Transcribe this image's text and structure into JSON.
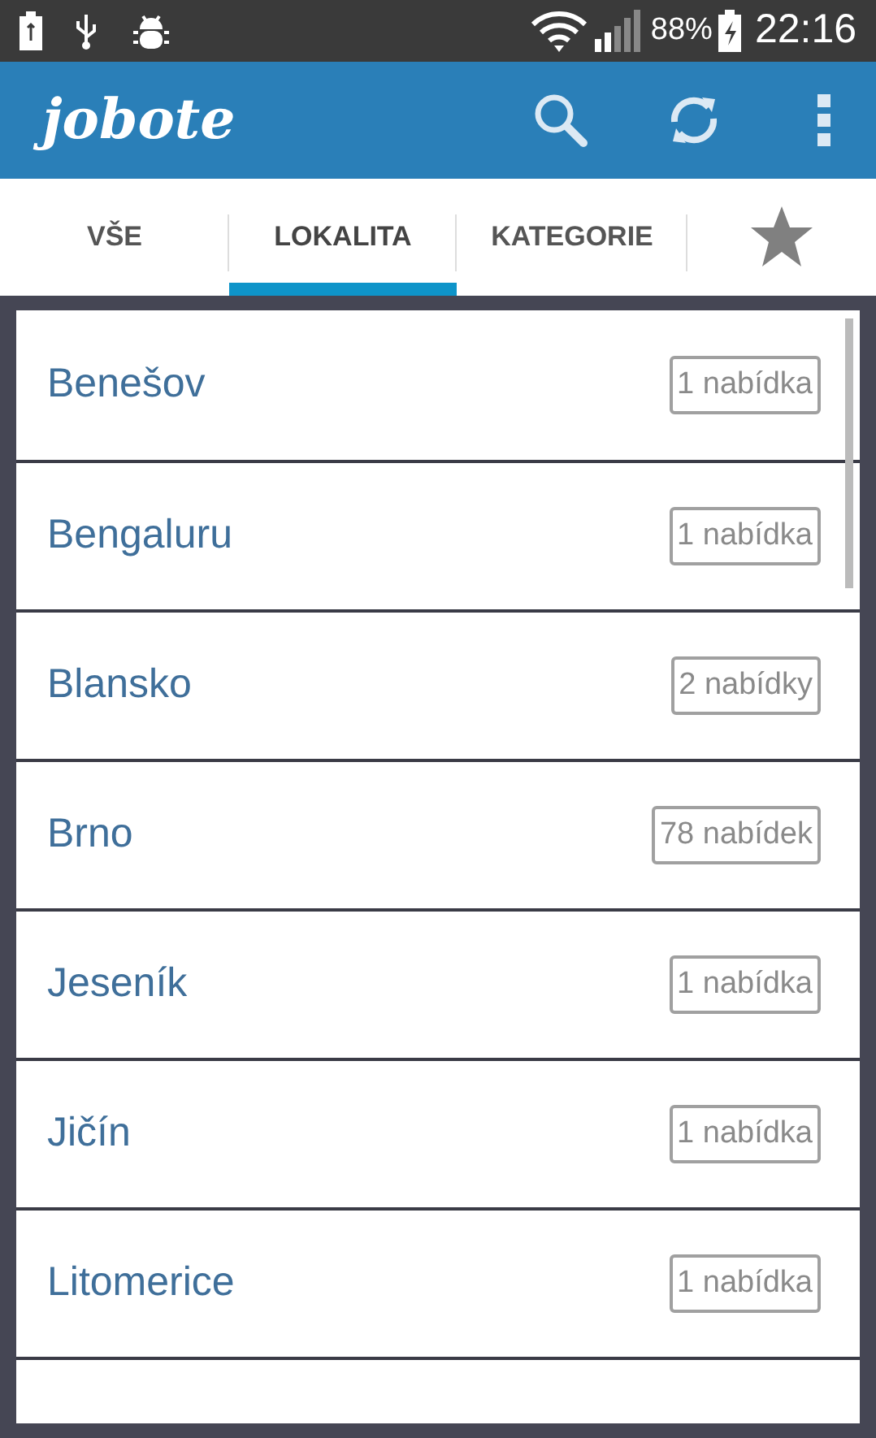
{
  "status_bar": {
    "battery_percent": "88%",
    "time": "22:16"
  },
  "app_bar": {
    "logo": "jobote"
  },
  "tabs": [
    {
      "kind": "text",
      "label": "VŠE",
      "selected": false
    },
    {
      "kind": "text",
      "label": "LOKALITA",
      "selected": true
    },
    {
      "kind": "text",
      "label": "KATEGORIE",
      "selected": false
    },
    {
      "kind": "star",
      "selected": false
    }
  ],
  "locations": [
    {
      "name": "Benešov",
      "count": "1 nabídka"
    },
    {
      "name": "Bengaluru",
      "count": "1 nabídka"
    },
    {
      "name": "Blansko",
      "count": "2 nabídky"
    },
    {
      "name": "Brno",
      "count": "78 nabídek"
    },
    {
      "name": "Jeseník",
      "count": "1 nabídka"
    },
    {
      "name": "Jičín",
      "count": "1 nabídka"
    },
    {
      "name": "Litomerice",
      "count": "1 nabídka"
    }
  ]
}
